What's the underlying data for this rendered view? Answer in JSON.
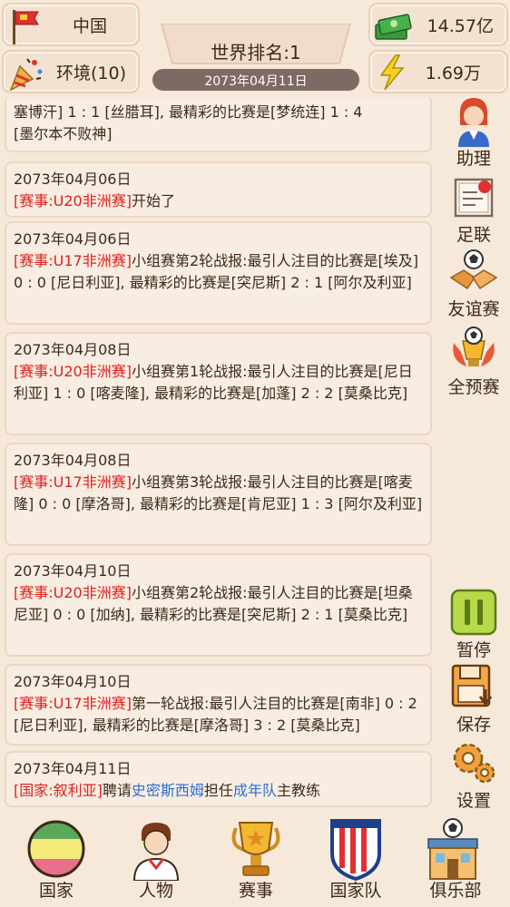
{
  "header": {
    "country": "中国",
    "environment": "环境(10)",
    "money": "14.57亿",
    "energy": "1.69万",
    "world_rank": "世界排名:1",
    "date": "2073年04月11日"
  },
  "log": [
    {
      "date": "",
      "parts": [
        {
          "t": "塞博汗] 1 : 1 [丝腊耳], 最精彩的比赛是[梦统连] 1 : 4"
        },
        {
          "t": "[墨尔本不败神]"
        }
      ]
    },
    {
      "date": "2073年04月06日",
      "parts": [
        {
          "t": "[赛事:U20非洲赛]",
          "c": "red"
        },
        {
          "t": "开始了"
        }
      ]
    },
    {
      "date": "2073年04月06日",
      "parts": [
        {
          "t": "[赛事:U17非洲赛]",
          "c": "red"
        },
        {
          "t": "小组赛第2轮战报:最引人注目的比赛是[埃及] 0 : 0 [尼日利亚], 最精彩的比赛是[突尼斯] 2 : 1 [阿尔及利亚]"
        }
      ]
    },
    {
      "date": "2073年04月08日",
      "parts": [
        {
          "t": "[赛事:U20非洲赛]",
          "c": "red"
        },
        {
          "t": "小组赛第1轮战报:最引人注目的比赛是[尼日利亚] 1 : 0 [喀麦隆], 最精彩的比赛是[加蓬] 2 : 2 [莫桑比克]"
        }
      ]
    },
    {
      "date": "2073年04月08日",
      "parts": [
        {
          "t": "[赛事:U17非洲赛]",
          "c": "red"
        },
        {
          "t": "小组赛第3轮战报:最引人注目的比赛是[喀麦隆] 0 : 0 [摩洛哥], 最精彩的比赛是[肯尼亚] 1 : 3 [阿尔及利亚]"
        }
      ]
    },
    {
      "date": "2073年04月10日",
      "parts": [
        {
          "t": "[赛事:U20非洲赛]",
          "c": "red"
        },
        {
          "t": "小组赛第2轮战报:最引人注目的比赛是[坦桑尼亚] 0 : 0 [加纳], 最精彩的比赛是[突尼斯] 2 : 1 [莫桑比克]"
        }
      ]
    },
    {
      "date": "2073年04月10日",
      "parts": [
        {
          "t": "[赛事:U17非洲赛]",
          "c": "red"
        },
        {
          "t": "第一轮战报:最引人注目的比赛是[南非] 0 : 2 [尼日利亚], 最精彩的比赛是[摩洛哥] 3 : 2 [莫桑比克]"
        }
      ]
    },
    {
      "date": "2073年04月11日",
      "parts": [
        {
          "t": "[国家:叙利亚]",
          "c": "red"
        },
        {
          "t": "聘请"
        },
        {
          "t": "史密斯西姆",
          "c": "blue"
        },
        {
          "t": "担任"
        },
        {
          "t": "成年队",
          "c": "blue"
        },
        {
          "t": "主教练"
        }
      ]
    }
  ],
  "side": {
    "assistant": "助理",
    "association": "足联",
    "friendly": "友谊赛",
    "qualifiers": "全预赛",
    "pause": "暂停",
    "save": "保存",
    "settings": "设置"
  },
  "nav": {
    "country": "国家",
    "people": "人物",
    "events": "赛事",
    "national_team": "国家队",
    "club": "俱乐部"
  },
  "colors": {
    "red": "#e02020",
    "blue": "#2b6fd8",
    "panel": "#f8ede2",
    "banner": "#7d6a62"
  }
}
